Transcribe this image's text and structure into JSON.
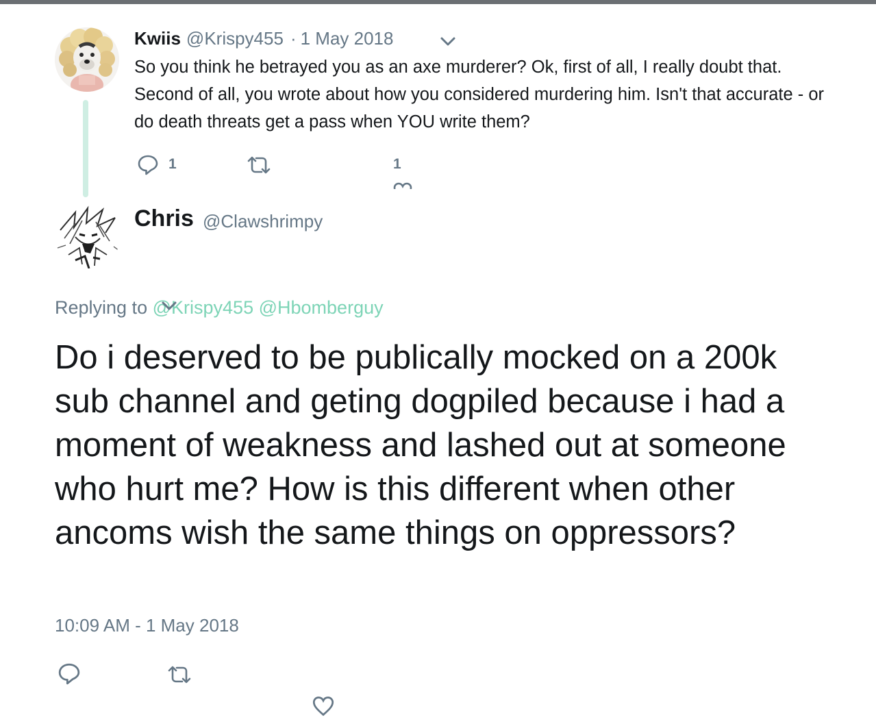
{
  "reply_tweet": {
    "display_name": "Kwiis",
    "handle": "@Krispy455",
    "separator": "·",
    "date": "1 May 2018",
    "text": "So you think he betrayed you as an axe murderer? Ok, first of all, I really doubt that. Second of all, you wrote about how you considered murdering him. Isn't that accurate - or do death threats get a pass when YOU write them?",
    "reply_count": "1",
    "like_count": "1",
    "icons": {
      "reply": "reply-icon",
      "retweet": "retweet-icon",
      "like": "heart-icon",
      "menu": "chevron-down-icon"
    }
  },
  "main_tweet": {
    "display_name": "Chris",
    "handle": "@Clawshrimpy",
    "replying_prefix": "Replying to",
    "replying_users": [
      "@Krispy455",
      "@Hbomberguy"
    ],
    "text": "Do i deserved to be publically mocked on a 200k sub channel and geting dogpiled because i had a moment of weakness and lashed out at someone who hurt me? How is this different when other ancoms wish the same things on oppressors?",
    "timestamp": "10:09 AM - 1 May 2018",
    "icons": {
      "reply": "reply-icon",
      "retweet": "retweet-icon",
      "like": "heart-icon"
    }
  },
  "colors": {
    "text": "#14171a",
    "secondary": "#657786",
    "accent": "#7dd4b6",
    "thread_line": "#cfeee3"
  }
}
